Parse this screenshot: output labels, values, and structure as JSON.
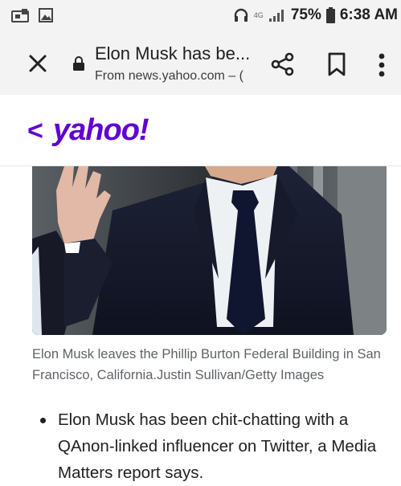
{
  "status_bar": {
    "battery": "75%",
    "time": "6:38 AM",
    "network": "4G"
  },
  "toolbar": {
    "title": "Elon Musk has be...",
    "url": "From news.yahoo.com – (",
    "icons": [
      "close-icon",
      "lock-icon",
      "share-icon",
      "bookmark-icon",
      "more-vert-icon"
    ]
  },
  "site_header": {
    "back": "<",
    "logo": "yahoo!",
    "brand_color": "#6001d2"
  },
  "article": {
    "caption": "Elon Musk leaves the Phillip Burton Federal Building in San Francisco, California.Justin Sullivan/Getty Images",
    "bullets": [
      "Elon Musk has been chit-chatting with a QAnon-linked influencer on Twitter, a Media Matters report says."
    ]
  }
}
